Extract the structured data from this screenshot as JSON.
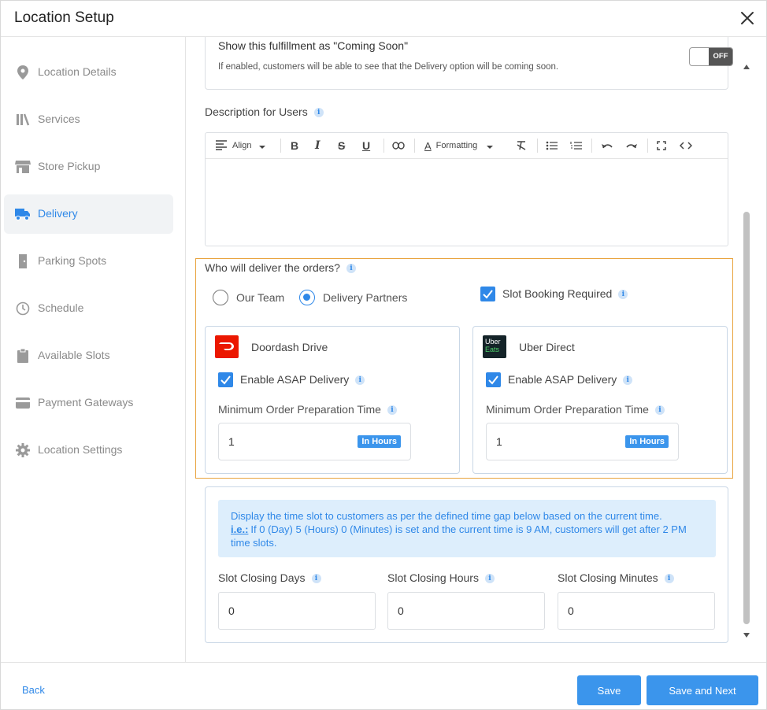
{
  "header": {
    "title": "Location Setup"
  },
  "sidebar": {
    "items": [
      {
        "label": "Location Details",
        "icon": "map-pin-icon"
      },
      {
        "label": "Services",
        "icon": "services-icon"
      },
      {
        "label": "Store Pickup",
        "icon": "store-icon"
      },
      {
        "label": "Delivery",
        "icon": "delivery-truck-icon"
      },
      {
        "label": "Parking Spots",
        "icon": "door-icon"
      },
      {
        "label": "Schedule",
        "icon": "clock-icon"
      },
      {
        "label": "Available Slots",
        "icon": "clipboard-icon"
      },
      {
        "label": "Payment Gateways",
        "icon": "card-icon"
      },
      {
        "label": "Location Settings",
        "icon": "gear-icon"
      }
    ],
    "active": "Delivery"
  },
  "coming_soon": {
    "title": "Show this fulfillment as \"Coming Soon\"",
    "description": "If enabled, customers will be able to see that the Delivery option will be coming soon.",
    "toggle_label": "OFF"
  },
  "description": {
    "label": "Description for Users",
    "toolbar": {
      "align_label": "Align",
      "formatting_label": "Formatting"
    }
  },
  "delivery": {
    "question": "Who will deliver the orders?",
    "options": {
      "our_team": "Our Team",
      "partners": "Delivery Partners"
    },
    "selected": "Delivery Partners",
    "slot_booking_label": "Slot Booking Required",
    "partners": [
      {
        "name": "Doordash Drive",
        "asap_label": "Enable ASAP Delivery",
        "min_label": "Minimum Order Preparation Time",
        "value": "1",
        "unit": "In Hours"
      },
      {
        "name": "Uber Direct",
        "logo_text_1": "Uber",
        "logo_text_2": "Eats",
        "asap_label": "Enable ASAP Delivery",
        "min_label": "Minimum Order Preparation Time",
        "value": "1",
        "unit": "In Hours"
      }
    ]
  },
  "slot_closing": {
    "notice_line1": "Display the time slot to customers as per the defined time gap below based on the current time.",
    "notice_ie": "i.e.:",
    "notice_line2": "If 0 (Day) 5 (Hours) 0 (Minutes) is set and the current time is 9 AM, customers will get after 2 PM time slots.",
    "fields": [
      {
        "label": "Slot Closing Days",
        "value": "0"
      },
      {
        "label": "Slot Closing Hours",
        "value": "0"
      },
      {
        "label": "Slot Closing Minutes",
        "value": "0"
      }
    ]
  },
  "footer": {
    "back_label": "Back",
    "save_label": "Save",
    "save_next_label": "Save and Next"
  },
  "colors": {
    "accent": "#2f88e8",
    "highlight_border": "#e8a33d",
    "doordash": "#eb1700",
    "uber": "#142328"
  }
}
